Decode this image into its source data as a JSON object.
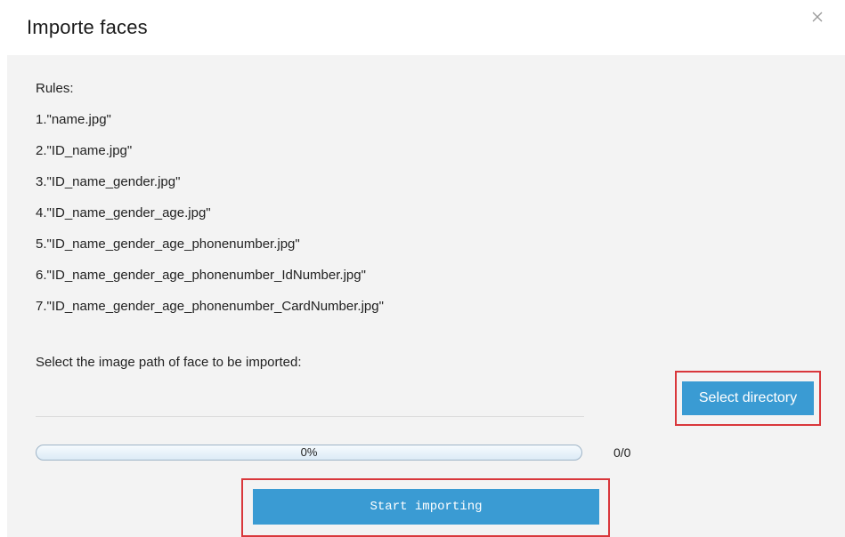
{
  "dialog": {
    "title": "Importe faces",
    "close_glyph": "×",
    "close_icon": "close-icon"
  },
  "rules": {
    "heading": "Rules:",
    "items": [
      "1.\"name.jpg\"",
      "2.\"ID_name.jpg\"",
      "3.\"ID_name_gender.jpg\"",
      "4.\"ID_name_gender_age.jpg\"",
      "5.\"ID_name_gender_age_phonenumber.jpg\"",
      "6.\"ID_name_gender_age_phonenumber_IdNumber.jpg\"",
      "7.\"ID_name_gender_age_phonenumber_CardNumber.jpg\""
    ]
  },
  "import": {
    "instruction": "Select the image path of face to be imported:",
    "path_value": "",
    "select_directory_label": "Select directory",
    "progress_percent": 0,
    "progress_text": "0%",
    "count_text": "0/0",
    "start_label": "Start importing"
  },
  "colors": {
    "accent": "#3a9bd3",
    "highlight": "#d9373b",
    "body_bg": "#f3f3f3"
  }
}
